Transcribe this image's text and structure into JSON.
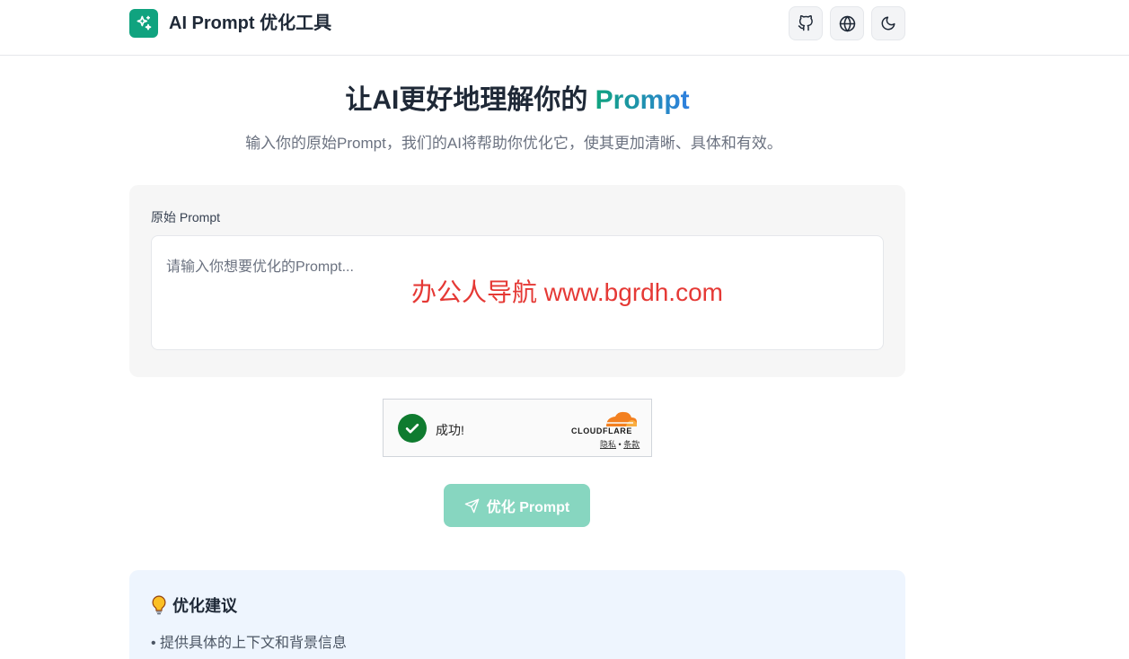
{
  "header": {
    "title": "AI Prompt 优化工具",
    "buttons": [
      {
        "name": "github",
        "icon": "github-icon"
      },
      {
        "name": "language",
        "icon": "globe-icon"
      },
      {
        "name": "theme",
        "icon": "moon-icon"
      }
    ]
  },
  "hero": {
    "title_main": "让AI更好地理解你的 ",
    "title_accent": "Prompt",
    "subtitle": "输入你的原始Prompt，我们的AI将帮助你优化它，使其更加清晰、具体和有效。"
  },
  "input_card": {
    "label": "原始 Prompt",
    "placeholder": "请输入你想要优化的Prompt...",
    "value": ""
  },
  "watermark": "办公人导航 www.bgrdh.com",
  "captcha": {
    "status": "成功!",
    "brand": "CLOUDFLARE",
    "privacy": "隐私",
    "separator": "•",
    "terms": "条款"
  },
  "submit": {
    "label": "优化 Prompt",
    "icon": "send-icon"
  },
  "tips": {
    "title": "优化建议",
    "icon": "lightbulb-icon",
    "items": [
      "提供具体的上下文和背景信息"
    ]
  },
  "colors": {
    "brand": "#10a37f",
    "accent_gradient_end": "#2f7fe0",
    "watermark": "#e53935",
    "success": "#0f7b2f"
  }
}
